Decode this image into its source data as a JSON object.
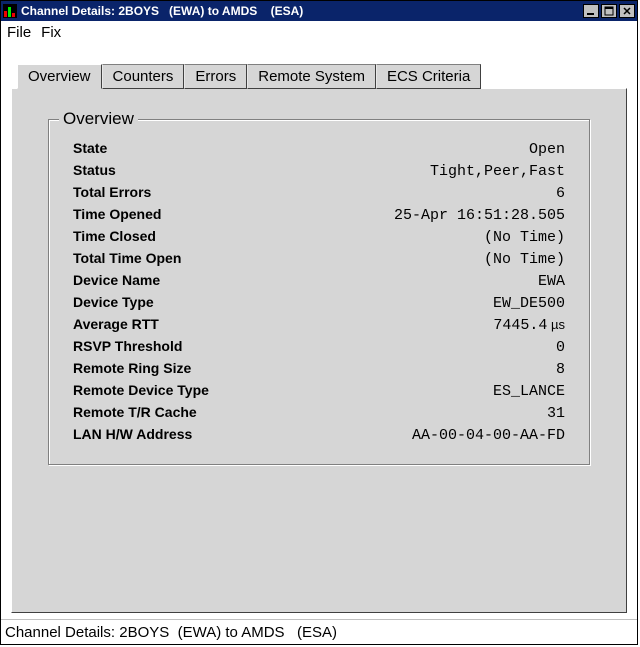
{
  "window": {
    "title": "Channel Details: 2BOYS   (EWA) to AMDS    (ESA)"
  },
  "menu": {
    "file": "File",
    "fix": "Fix"
  },
  "tabs": {
    "overview": "Overview",
    "counters": "Counters",
    "errors": "Errors",
    "remote_system": "Remote System",
    "ecs_criteria": "ECS Criteria"
  },
  "overview": {
    "legend": "Overview",
    "rows": {
      "state_label": "State",
      "state_value": "Open",
      "status_label": "Status",
      "status_value": "Tight,Peer,Fast",
      "total_errors_label": "Total Errors",
      "total_errors_value": "6",
      "time_opened_label": "Time Opened",
      "time_opened_value": "25-Apr 16:51:28.505",
      "time_closed_label": "Time Closed",
      "time_closed_value": "(No Time)",
      "total_time_open_label": "Total Time Open",
      "total_time_open_value": "(No Time)",
      "device_name_label": "Device Name",
      "device_name_value": "EWA",
      "device_type_label": "Device Type",
      "device_type_value": "EW_DE500",
      "avg_rtt_label": "Average RTT",
      "avg_rtt_value": "7445.4",
      "avg_rtt_unit": " µs",
      "rsvp_label": "RSVP Threshold",
      "rsvp_value": "0",
      "ring_label": "Remote Ring Size",
      "ring_value": "8",
      "rdev_label": "Remote Device Type",
      "rdev_value": "ES_LANCE",
      "trcache_label": "Remote T/R Cache",
      "trcache_value": "31",
      "lanhw_label": "LAN H/W Address",
      "lanhw_value": "AA-00-04-00-AA-FD"
    }
  },
  "statusbar": {
    "text": "Channel Details: 2BOYS  (EWA) to AMDS   (ESA)"
  }
}
